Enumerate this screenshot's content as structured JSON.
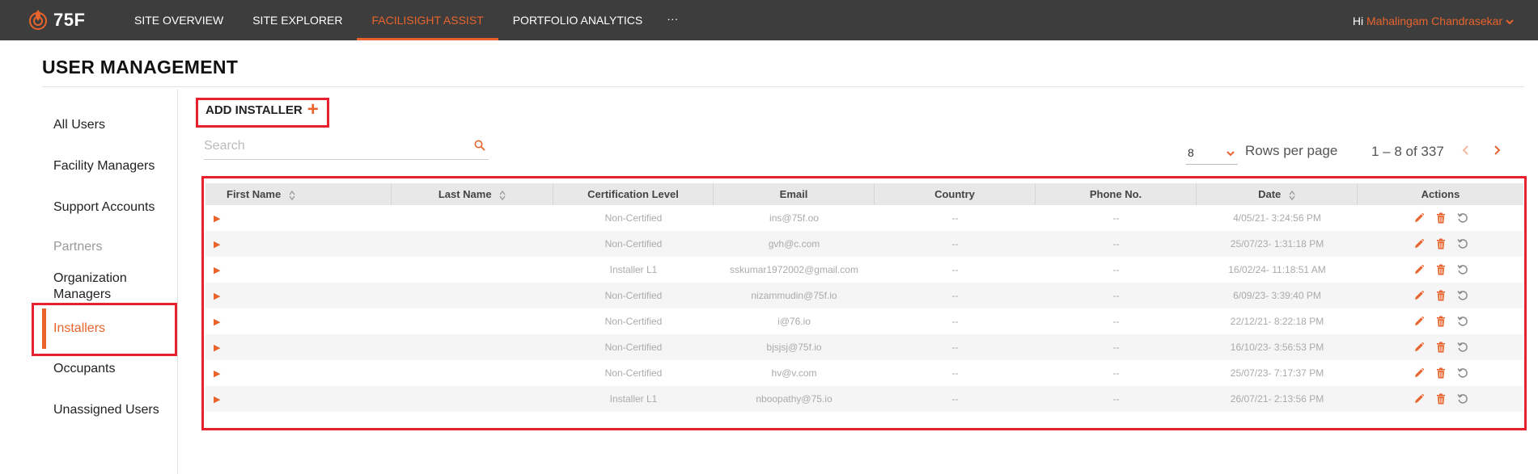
{
  "brand": {
    "logo_text": "75F"
  },
  "nav": {
    "items": [
      {
        "label": "SITE OVERVIEW"
      },
      {
        "label": "SITE EXPLORER"
      },
      {
        "label": "FACILISIGHT ASSIST"
      },
      {
        "label": "PORTFOLIO ANALYTICS"
      }
    ],
    "more_label": "···",
    "active_index": 2
  },
  "greeting": {
    "prefix": "Hi",
    "user": "Mahalingam Chandrasekar"
  },
  "page": {
    "title": "USER MANAGEMENT"
  },
  "sidebar": {
    "items": [
      {
        "label": "All Users"
      },
      {
        "label": "Facility Managers"
      },
      {
        "label": "Support Accounts"
      },
      {
        "label": "Partners"
      },
      {
        "label": "Organization Managers"
      },
      {
        "label": "Installers"
      },
      {
        "label": "Occupants"
      },
      {
        "label": "Unassigned Users"
      }
    ],
    "active_label": "Installers"
  },
  "toolbar": {
    "add_label": "ADD INSTALLER",
    "add_symbol": "+"
  },
  "search": {
    "placeholder": "Search",
    "value": ""
  },
  "pagination": {
    "rows_per_page_value": "8",
    "rows_per_page_label": "Rows per page",
    "range_text": "1 – 8 of 337"
  },
  "table": {
    "columns": [
      {
        "label": "First Name",
        "sortable": true
      },
      {
        "label": "Last Name",
        "sortable": true
      },
      {
        "label": "Certification Level",
        "sortable": false
      },
      {
        "label": "Email",
        "sortable": false
      },
      {
        "label": "Country",
        "sortable": false
      },
      {
        "label": "Phone No.",
        "sortable": false
      },
      {
        "label": "Date",
        "sortable": true
      },
      {
        "label": "Actions",
        "sortable": false
      }
    ],
    "rows": [
      {
        "first": "",
        "last": "",
        "cert": "Non-Certified",
        "email": "ins@75f.oo",
        "country": "--",
        "phone": "--",
        "date": "4/05/21- 3:24:56 PM"
      },
      {
        "first": "",
        "last": "",
        "cert": "Non-Certified",
        "email": "gvh@c.com",
        "country": "--",
        "phone": "--",
        "date": "25/07/23- 1:31:18 PM"
      },
      {
        "first": "",
        "last": "",
        "cert": "Installer L1",
        "email": "sskumar1972002@gmail.com",
        "country": "--",
        "phone": "--",
        "date": "16/02/24- 11:18:51 AM"
      },
      {
        "first": "",
        "last": "",
        "cert": "Non-Certified",
        "email": "nizammudin@75f.io",
        "country": "--",
        "phone": "--",
        "date": "6/09/23- 3:39:40 PM"
      },
      {
        "first": "",
        "last": "",
        "cert": "Non-Certified",
        "email": "i@76.io",
        "country": "--",
        "phone": "--",
        "date": "22/12/21- 8:22:18 PM"
      },
      {
        "first": "",
        "last": "",
        "cert": "Non-Certified",
        "email": "bjsjsj@75f.io",
        "country": "--",
        "phone": "--",
        "date": "16/10/23- 3:56:53 PM"
      },
      {
        "first": "",
        "last": "",
        "cert": "Non-Certified",
        "email": "hv@v.com",
        "country": "--",
        "phone": "--",
        "date": "25/07/23- 7:17:37 PM"
      },
      {
        "first": "",
        "last": "",
        "cert": "Installer L1",
        "email": "nboopathy@75.io",
        "country": "--",
        "phone": "--",
        "date": "26/07/21- 2:13:56 PM"
      }
    ]
  },
  "colors": {
    "accent": "#e8642c",
    "topbar": "#3d3d3d",
    "highlight": "#e8212e"
  }
}
